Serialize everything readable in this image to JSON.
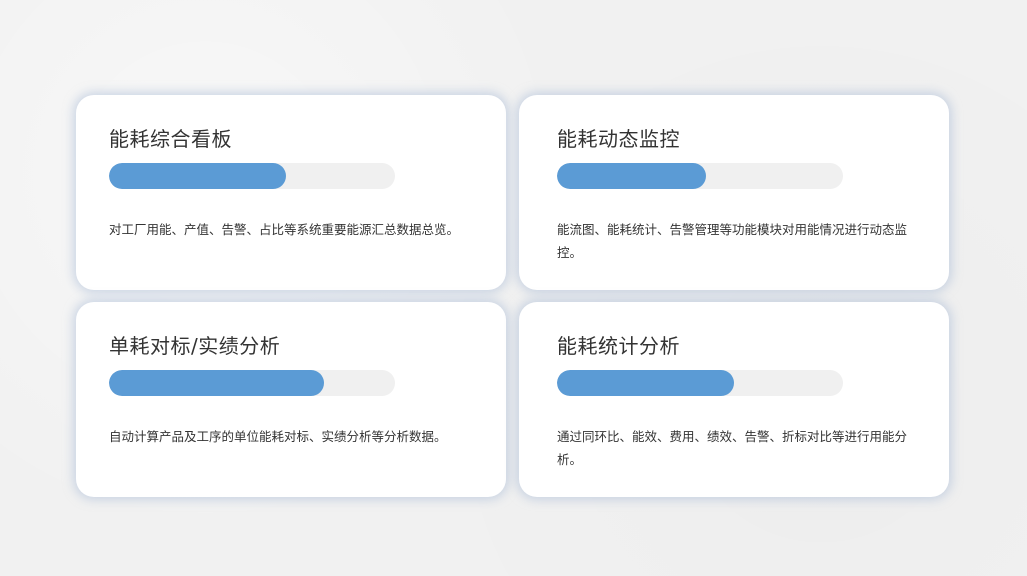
{
  "cards": [
    {
      "title": "能耗综合看板",
      "progress": 0.62,
      "description": "对工厂用能、产值、告警、占比等系统重要能源汇总数据总览。"
    },
    {
      "title": "能耗动态监控",
      "progress": 0.52,
      "description": "能流图、能耗统计、告警管理等功能模块对用能情况进行动态监控。"
    },
    {
      "title": "单耗对标/实绩分析",
      "progress": 0.75,
      "description": "自动计算产品及工序的单位能耗对标、实绩分析等分析数据。"
    },
    {
      "title": "能耗统计分析",
      "progress": 0.62,
      "description": "通过同环比、能效、费用、绩效、告警、折标对比等进行用能分析。"
    }
  ],
  "colors": {
    "progress_fill": "#5b9bd5",
    "progress_track": "#f0f0f0",
    "card_background": "#ffffff",
    "page_background": "#f1f1f1"
  }
}
